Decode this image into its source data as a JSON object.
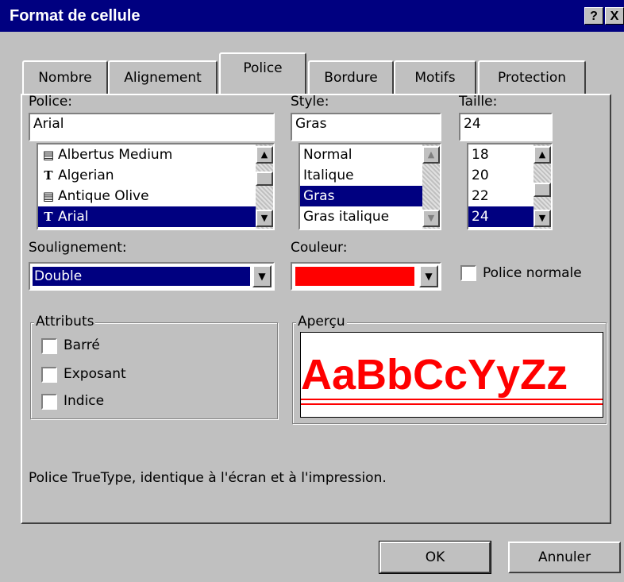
{
  "title": "Format de cellule",
  "title_buttons": {
    "help": "?",
    "close": "X"
  },
  "tabs": [
    "Nombre",
    "Alignement",
    "Police",
    "Bordure",
    "Motifs",
    "Protection"
  ],
  "active_tab": "Police",
  "font": {
    "label": "Police:",
    "value": "Arial",
    "items": [
      {
        "icon": "printer-font-icon",
        "glyph": "🖨",
        "label": "Albertus Medium"
      },
      {
        "icon": "truetype-font-icon",
        "glyph": "T",
        "label": "Algerian"
      },
      {
        "icon": "printer-font-icon",
        "glyph": "🖨",
        "label": "Antique Olive"
      },
      {
        "icon": "truetype-font-icon",
        "glyph": "T",
        "label": "Arial"
      }
    ],
    "selected_index": 3
  },
  "style": {
    "label": "Style:",
    "value": "Gras",
    "items": [
      "Normal",
      "Italique",
      "Gras",
      "Gras italique"
    ],
    "selected_index": 2
  },
  "size": {
    "label": "Taille:",
    "value": "24",
    "items": [
      "18",
      "20",
      "22",
      "24"
    ],
    "selected_index": 3
  },
  "underline": {
    "label": "Soulignement:",
    "value": "Double"
  },
  "color": {
    "label": "Couleur:",
    "value": "#ff0000"
  },
  "normal_font": {
    "label": "Police normale",
    "checked": false
  },
  "attributes": {
    "legend": "Attributs",
    "items": [
      {
        "label": "Barré",
        "checked": false
      },
      {
        "label": "Exposant",
        "checked": false
      },
      {
        "label": "Indice",
        "checked": false
      }
    ]
  },
  "preview": {
    "legend": "Aperçu",
    "sample": "AaBbCcYyZz",
    "color": "#ff0000"
  },
  "info_text": "Police TrueType, identique à l'écran et à l'impression.",
  "buttons": {
    "ok": "OK",
    "cancel": "Annuler"
  },
  "colors": {
    "titlebar": "#000080",
    "face": "#c0c0c0",
    "selection": "#000080"
  }
}
